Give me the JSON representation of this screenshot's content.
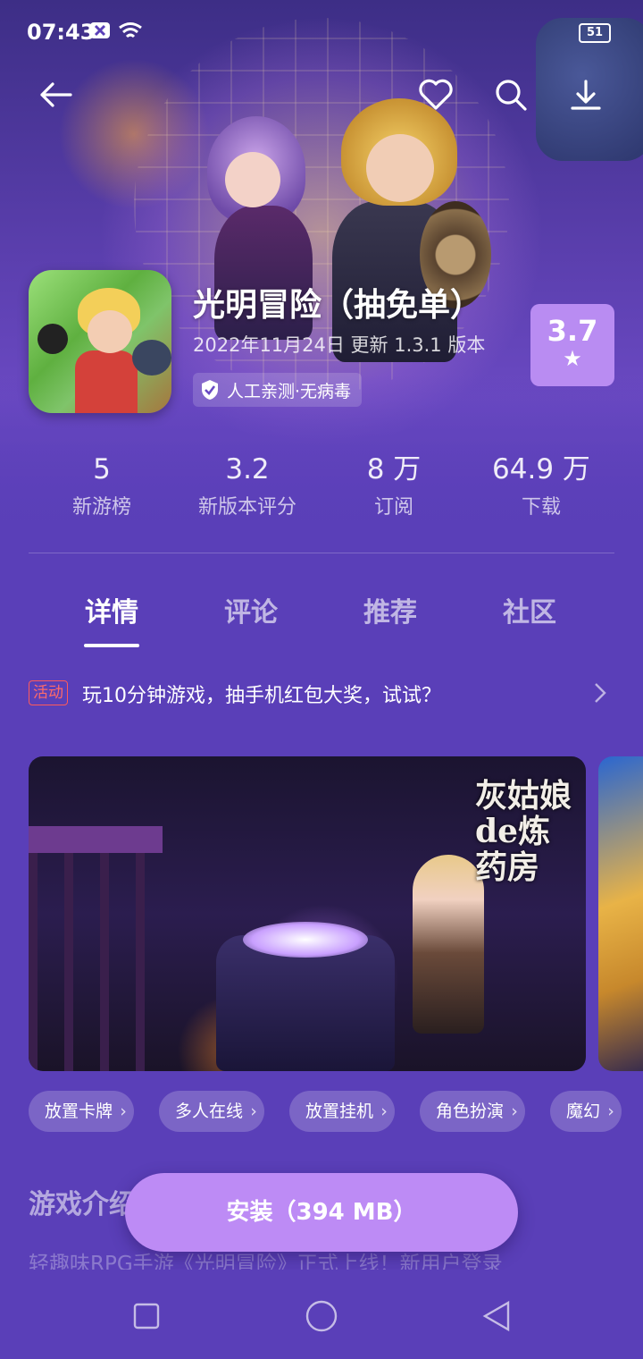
{
  "status_bar": {
    "time": "07:43",
    "battery": "51"
  },
  "app": {
    "title": "光明冒险（抽免单）",
    "meta": "2022年11月24日 更新 1.3.1 版本",
    "safety_badge": "人工亲测·无病毒",
    "rating": "3.7"
  },
  "stats": [
    {
      "value": "5",
      "label": "新游榜"
    },
    {
      "value": "3.2",
      "label": "新版本评分"
    },
    {
      "value": "8 万",
      "label": "订阅"
    },
    {
      "value": "64.9 万",
      "label": "下载"
    }
  ],
  "tabs": [
    {
      "label": "详情",
      "active": true
    },
    {
      "label": "评论",
      "active": false
    },
    {
      "label": "推荐",
      "active": false
    },
    {
      "label": "社区",
      "active": false
    }
  ],
  "promo": {
    "tag": "活动",
    "text": "玩10分钟游戏，抽手机红包大奖，试试？"
  },
  "screenshot": {
    "title_text": "灰姑娘de炼药房"
  },
  "tags": [
    "放置卡牌",
    "多人在线",
    "放置挂机",
    "角色扮演",
    "魔幻"
  ],
  "intro": {
    "title": "游戏介绍",
    "text": "轻趣味RPG手游《光明冒险》正式上线！新用户登录"
  },
  "install_button": "安装（394 MB）",
  "icons": [
    "back-arrow-icon",
    "heart-icon",
    "search-icon",
    "download-icon",
    "shield-check-icon",
    "star-icon",
    "chevron-right-icon",
    "square-nav-icon",
    "circle-nav-icon",
    "triangle-back-nav-icon"
  ],
  "colors": {
    "background": "#5a3fb8",
    "accent": "#bd8bf5",
    "rating_bg": "#b98cf2",
    "promo_tag": "#ff5a5a"
  }
}
